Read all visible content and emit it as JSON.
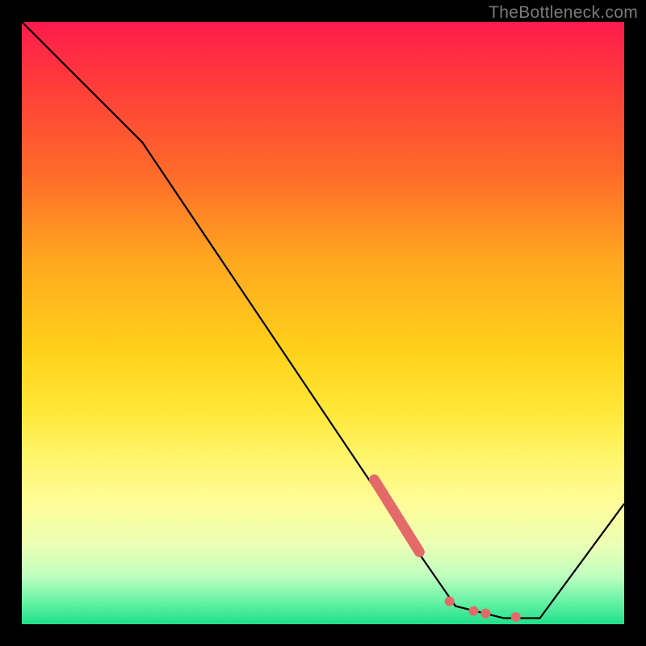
{
  "watermark": "TheBottleneck.com",
  "chart_data": {
    "type": "line",
    "title": "",
    "xlabel": "",
    "ylabel": "",
    "xlim": [
      0,
      100
    ],
    "ylim": [
      0,
      100
    ],
    "curve": [
      {
        "x": 0,
        "y": 100
      },
      {
        "x": 10,
        "y": 90
      },
      {
        "x": 20,
        "y": 80
      },
      {
        "x": 63,
        "y": 16
      },
      {
        "x": 72,
        "y": 3
      },
      {
        "x": 80,
        "y": 1
      },
      {
        "x": 86,
        "y": 1
      },
      {
        "x": 100,
        "y": 20
      }
    ],
    "markers": {
      "segment": {
        "x1": 58.5,
        "y1": 24,
        "x2": 66,
        "y2": 12
      },
      "dots": [
        {
          "x": 71,
          "y": 3.8
        },
        {
          "x": 75,
          "y": 2.2
        },
        {
          "x": 77,
          "y": 1.8
        },
        {
          "x": 82,
          "y": 1.2
        }
      ]
    },
    "colors": {
      "curve": "#000000",
      "marker": "#e46a6a"
    }
  }
}
